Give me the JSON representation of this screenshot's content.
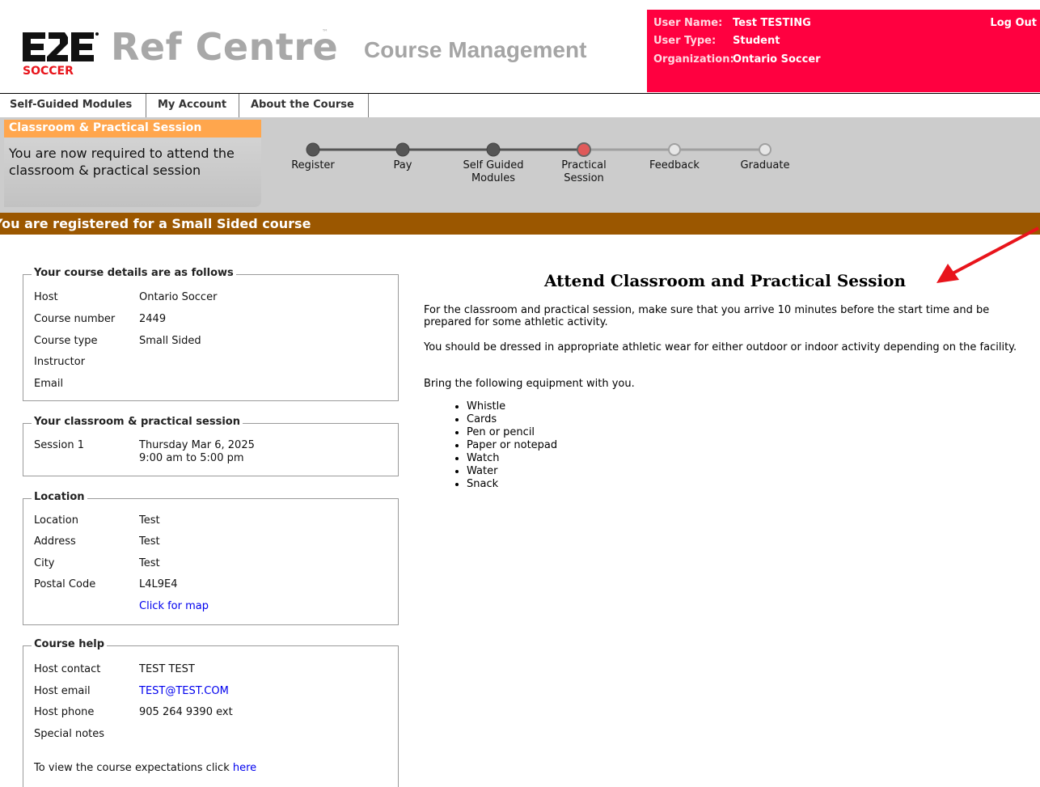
{
  "header": {
    "brand": "Ref Centre",
    "brand_tm": "™",
    "logo_text": "SOCCER",
    "product": "Course Management",
    "user": {
      "name_label": "User Name:",
      "name_value": "Test TESTING",
      "type_label": "User Type:",
      "type_value": "Student",
      "org_label": "Organization:",
      "org_value": "Ontario Soccer"
    },
    "logout_label": "Log Out",
    "colors": {
      "user_panel": "#ff0040",
      "brand_grey": "#a8a8a8"
    }
  },
  "nav": {
    "tabs": [
      {
        "label": "Self-Guided Modules"
      },
      {
        "label": "My Account"
      },
      {
        "label": "About the Course"
      }
    ]
  },
  "progress": {
    "stage_title": "Classroom & Practical Session",
    "stage_text": "You are now required to attend the classroom & practical session",
    "steps": [
      {
        "label": "Register",
        "state": "done"
      },
      {
        "label": "Pay",
        "state": "done"
      },
      {
        "label": "Self Guided Modules",
        "state": "done"
      },
      {
        "label": "Practical Session",
        "state": "current"
      },
      {
        "label": "Feedback",
        "state": "todo"
      },
      {
        "label": "Graduate",
        "state": "todo"
      }
    ],
    "colors": {
      "stage_title_bg": "#ffa64d",
      "current_dot": "#e05a5a",
      "done_dot": "#555555"
    }
  },
  "registration": {
    "text": "You are registered for a Small Sided course",
    "color": "#9b5700"
  },
  "course_details": {
    "legend": "Your course details are as follows",
    "rows": [
      {
        "k": "Host",
        "v": "Ontario Soccer"
      },
      {
        "k": "Course number",
        "v": "2449"
      },
      {
        "k": "Course type",
        "v": "Small Sided"
      },
      {
        "k": "Instructor",
        "v": ""
      },
      {
        "k": "Email",
        "v": ""
      }
    ]
  },
  "session": {
    "legend": "Your classroom & practical session",
    "label": "Session 1",
    "date": "Thursday Mar 6, 2025",
    "time": "9:00 am to 5:00 pm"
  },
  "location": {
    "legend": "Location",
    "rows": [
      {
        "k": "Location",
        "v": "Test"
      },
      {
        "k": "Address",
        "v": "Test"
      },
      {
        "k": "City",
        "v": "Test"
      },
      {
        "k": "Postal Code",
        "v": "L4L9E4"
      }
    ],
    "map_link": "Click for map"
  },
  "course_help": {
    "legend": "Course help",
    "contact_label": "Host contact",
    "contact_value": "TEST TEST",
    "email_label": "Host email",
    "email_value": "TEST@TEST.COM",
    "phone_label": "Host phone",
    "phone_value": "905 264 9390 ext",
    "notes_label": "Special notes",
    "expectations_text": "To view the course expectations click",
    "expectations_link": "here"
  },
  "main": {
    "title": "Attend Classroom and Practical Session",
    "para1": "For the classroom and practical session, make sure that you arrive 10 minutes before the start time and be prepared for some athletic activity.",
    "para2": "You should be dressed in appropriate athletic wear for either outdoor or indoor activity depending on the facility.",
    "para3": "Bring the following equipment with you.",
    "equipment": [
      "Whistle",
      "Cards",
      "Pen or pencil",
      "Paper or notepad",
      "Watch",
      "Water",
      "Snack"
    ]
  },
  "annotation": {
    "arrow_color": "#e8141b"
  }
}
